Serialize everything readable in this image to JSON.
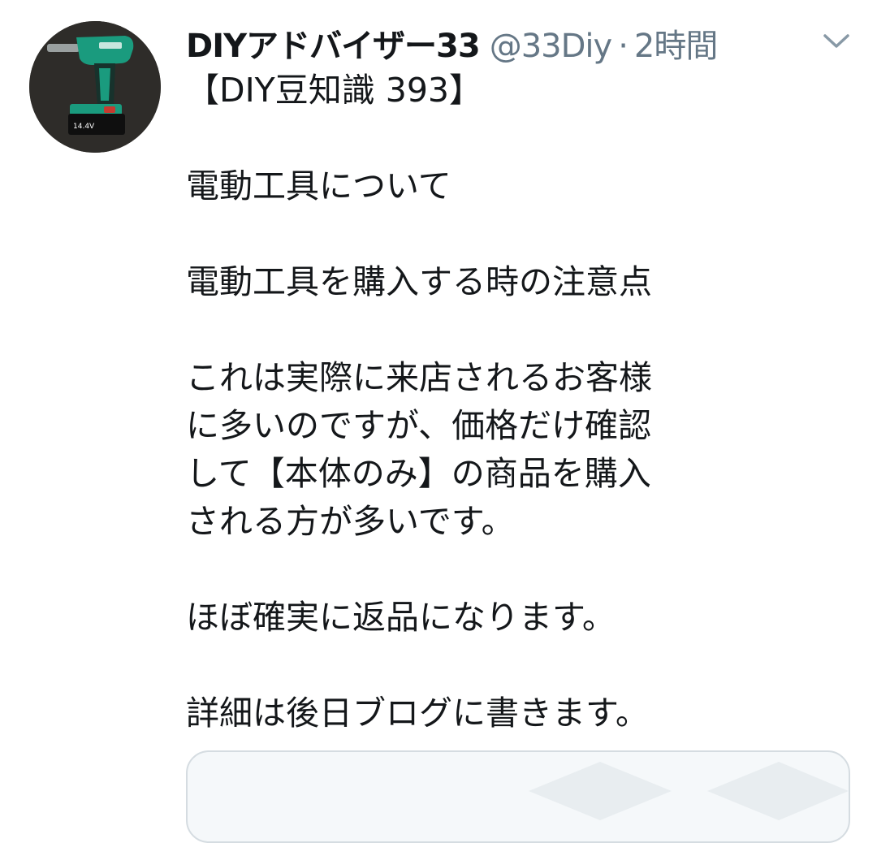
{
  "tweet": {
    "display_name": "DIYアドバイザー33",
    "handle": "@33Diy",
    "separator": "·",
    "time": "2時間",
    "avatar_icon": "power-drill-icon",
    "menu_icon": "chevron-down-icon",
    "lines": [
      "【DIY豆知識 393】",
      "電動工具について",
      "電動工具を購入する時の注意点",
      "これは実際に来店されるお客様",
      "に多いのですが、価格だけ確認",
      "して【本体のみ】の商品を購入",
      "される方が多いです。",
      "ほぼ確実に返品になります。",
      "詳細は後日ブログに書きます。"
    ],
    "card_icon": "link-card-placeholder-icon"
  },
  "colors": {
    "text_primary": "#14171a",
    "text_secondary": "#657786",
    "card_bg": "#f5f8fa",
    "card_border": "#d5dce1",
    "drill_green": "#1a9b7e"
  }
}
